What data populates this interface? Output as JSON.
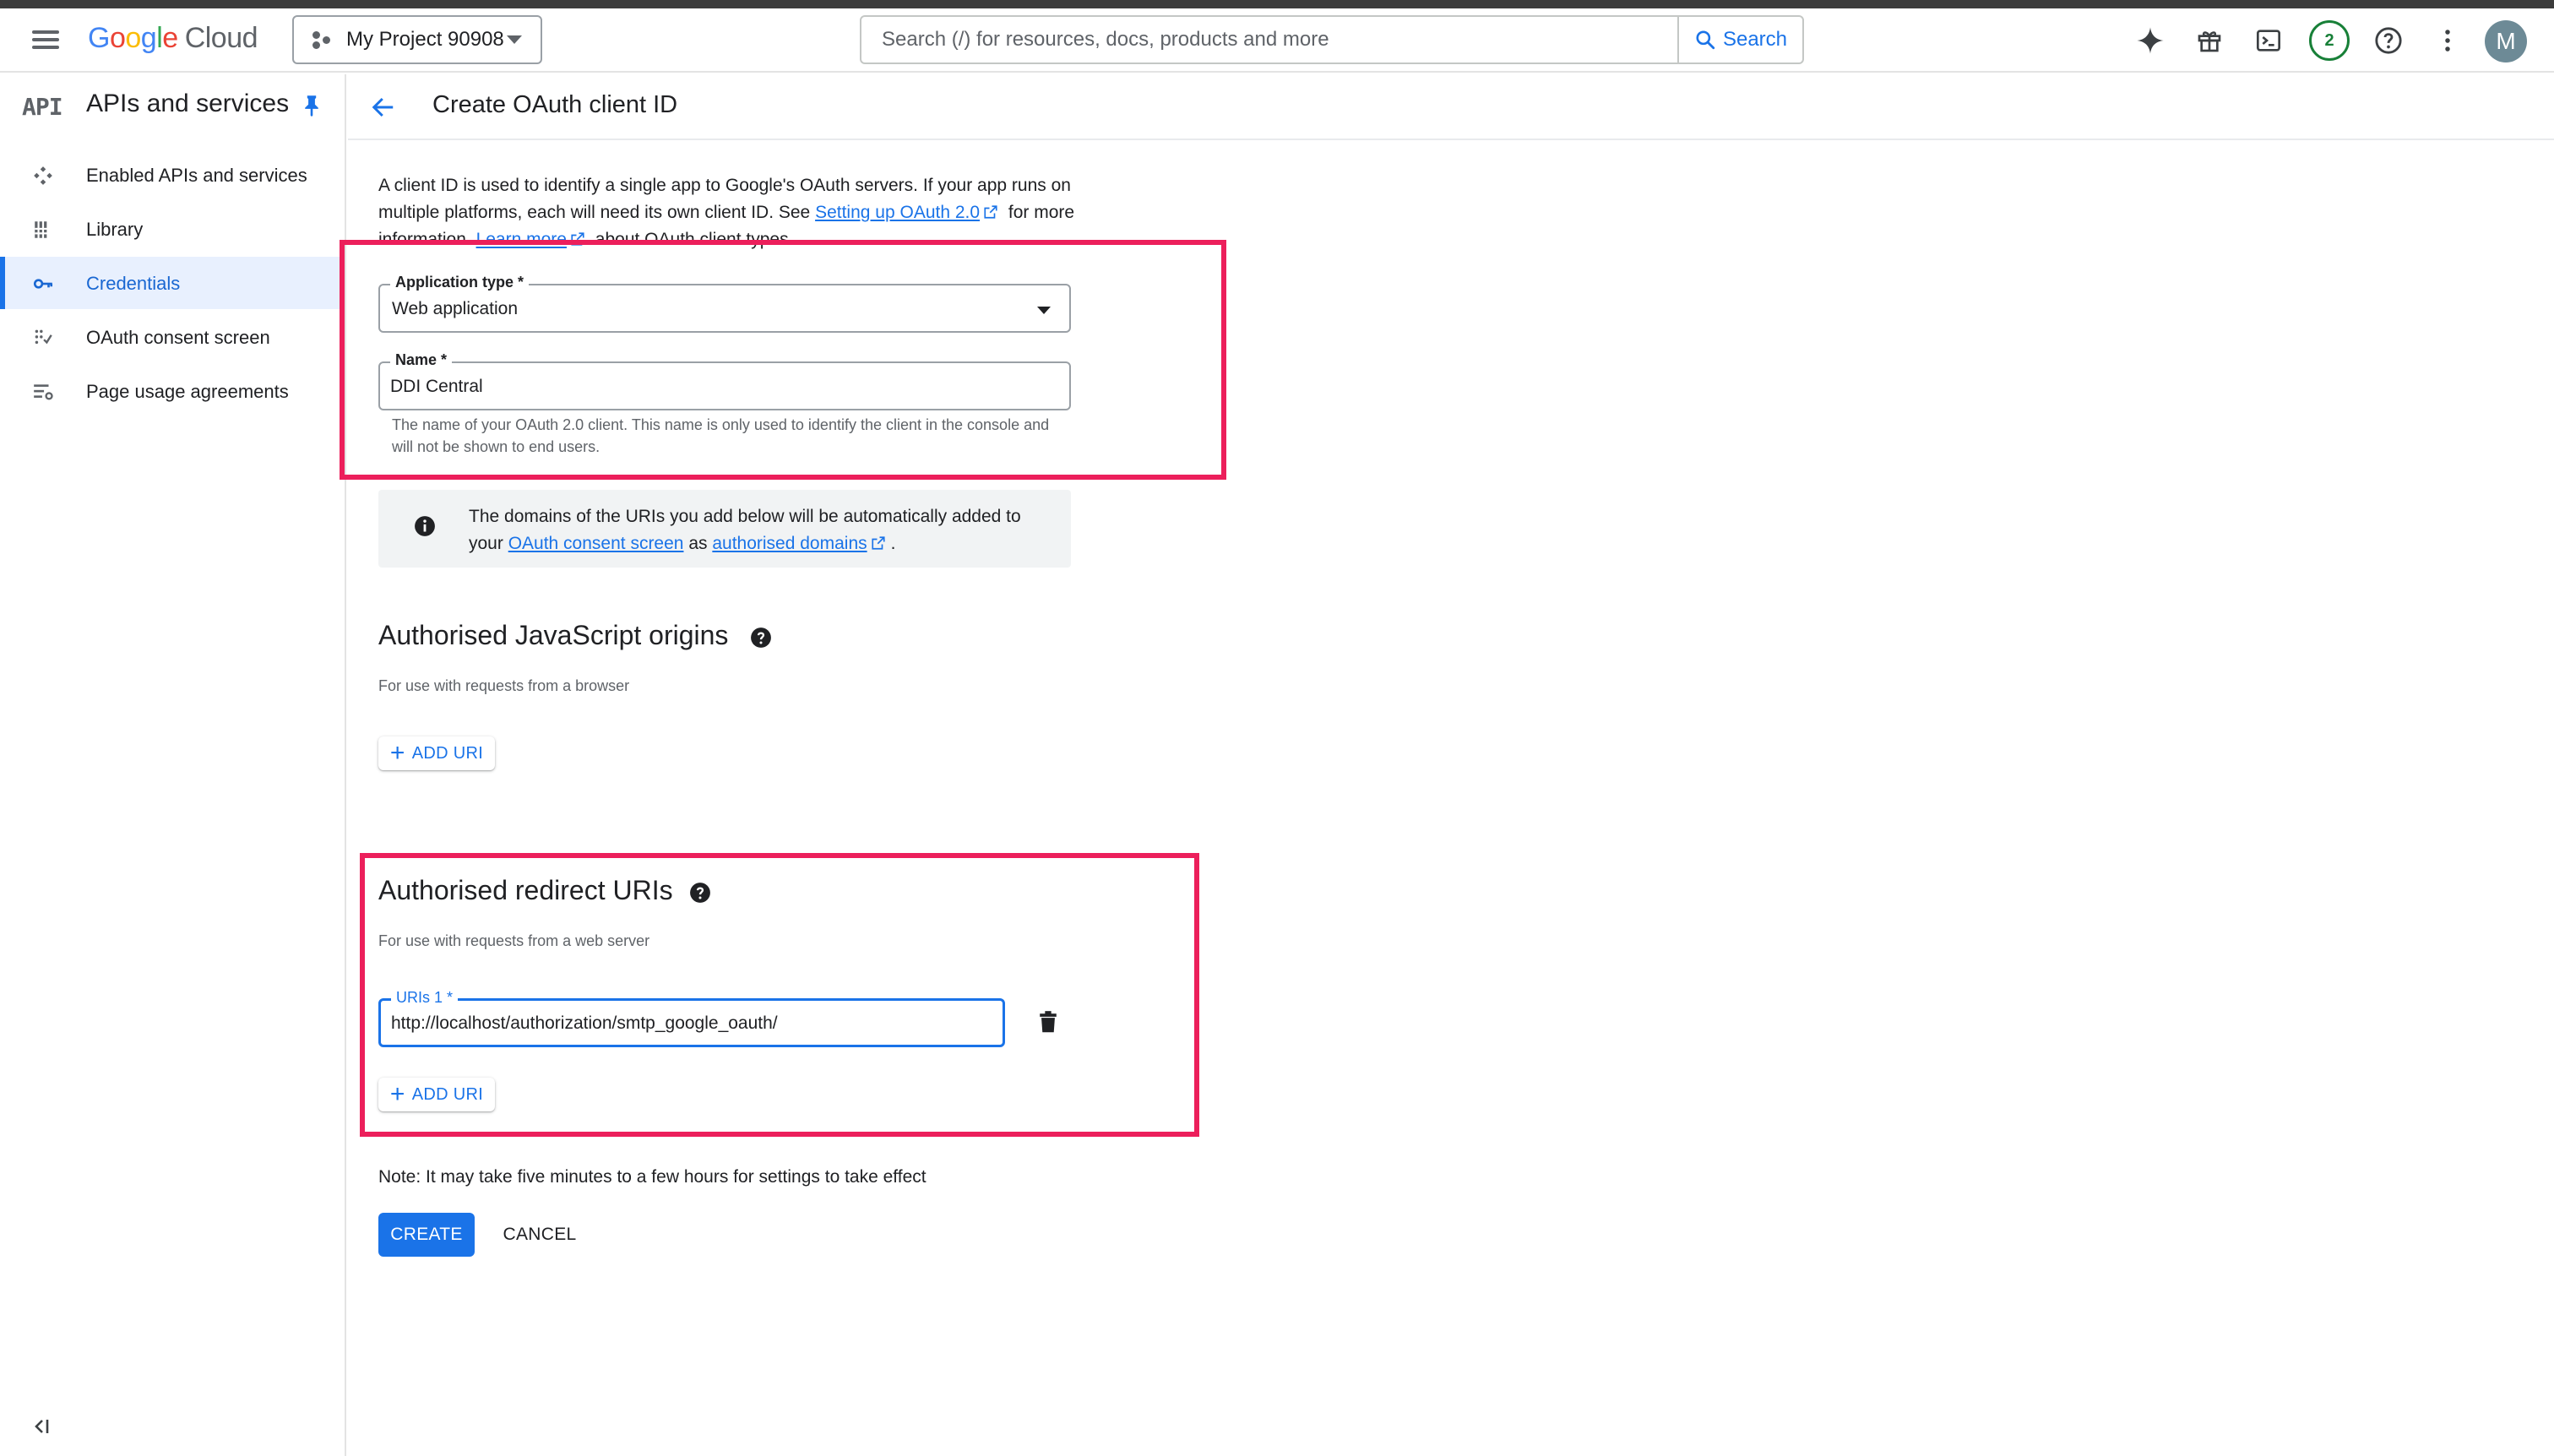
{
  "header": {
    "logo_letters": [
      "G",
      "o",
      "o",
      "g",
      "l",
      "e"
    ],
    "logo_product": "Cloud",
    "project_name": "My Project 90908",
    "search_placeholder": "Search (/) for resources, docs, products and more",
    "search_button": "Search",
    "notification_count": "2",
    "avatar_initial": "M",
    "icons": [
      "menu-icon",
      "project-icon",
      "search-icon",
      "gemini-sparkle-icon",
      "gift-icon",
      "cloud-shell-icon",
      "help-icon",
      "more-vert-icon"
    ]
  },
  "sidebar": {
    "badge": "API",
    "title": "APIs and services",
    "items": [
      {
        "label": "Enabled APIs and services",
        "icon": "enabled-apis-icon",
        "active": false
      },
      {
        "label": "Library",
        "icon": "library-icon",
        "active": false
      },
      {
        "label": "Credentials",
        "icon": "key-icon",
        "active": true
      },
      {
        "label": "OAuth consent screen",
        "icon": "oauth-consent-icon",
        "active": false
      },
      {
        "label": "Page usage agreements",
        "icon": "settings-list-icon",
        "active": false
      }
    ]
  },
  "page": {
    "title": "Create OAuth client ID",
    "intro_part1": "A client ID is used to identify a single app to Google's OAuth servers. If your app runs on multiple platforms, each will need its own client ID. See ",
    "intro_link1": "Setting up OAuth 2.0",
    "intro_part2": " for more information. ",
    "intro_link2": "Learn more",
    "intro_part3": " about OAuth client types."
  },
  "form": {
    "app_type_label": "Application type *",
    "app_type_value": "Web application",
    "name_label": "Name *",
    "name_value": "DDI Central",
    "name_helper": "The name of your OAuth 2.0 client. This name is only used to identify the client in the console and will not be shown to end users."
  },
  "info": {
    "text1": "The domains of the URIs you add below will be automatically added to your ",
    "link1": "OAuth consent screen",
    "text2": " as ",
    "link2": "authorised domains",
    "text3": "."
  },
  "js_origins": {
    "title": "Authorised JavaScript origins",
    "subtitle": "For use with requests from a browser",
    "add_button": "ADD URI"
  },
  "redirect_uris": {
    "title": "Authorised redirect URIs",
    "subtitle": "For use with requests from a web server",
    "uri_label": "URIs 1 *",
    "uri_value": "http://localhost/authorization/smtp_google_oauth/",
    "add_button": "ADD URI"
  },
  "footer": {
    "note": "Note: It may take five minutes to a few hours for settings to take effect",
    "create_button": "CREATE",
    "cancel_button": "CANCEL"
  },
  "colors": {
    "accent": "#1a73e8",
    "highlight": "#ec1f5b",
    "active_nav_bg": "#e8f0fe",
    "notification": "#188038"
  }
}
